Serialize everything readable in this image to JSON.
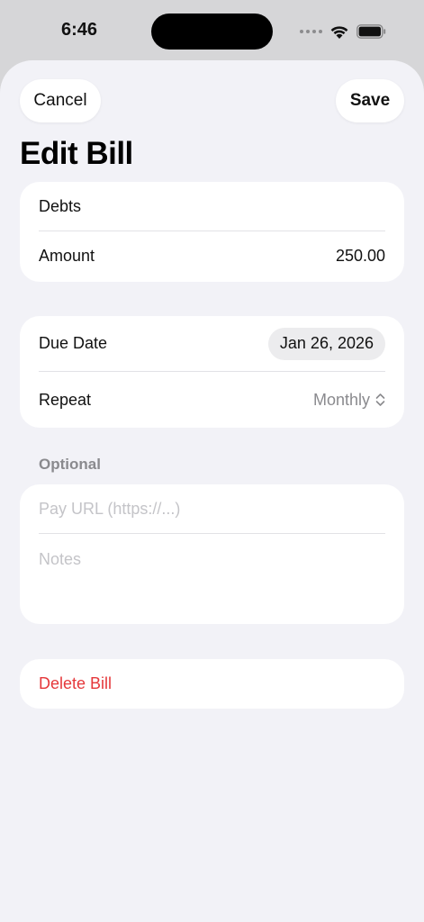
{
  "status_bar": {
    "time": "6:46"
  },
  "header": {
    "cancel_label": "Cancel",
    "save_label": "Save",
    "title": "Edit Bill"
  },
  "bill": {
    "name": "Debts",
    "amount_label": "Amount",
    "amount_value": "250.00"
  },
  "schedule": {
    "due_date_label": "Due Date",
    "due_date_value": "Jan 26, 2026",
    "repeat_label": "Repeat",
    "repeat_value": "Monthly"
  },
  "optional": {
    "header": "Optional",
    "pay_url_placeholder": "Pay URL (https://...)",
    "notes_placeholder": "Notes"
  },
  "actions": {
    "delete_label": "Delete Bill"
  },
  "colors": {
    "accent_destructive": "#e5383b",
    "background": "#f2f2f7",
    "secondary_text": "#8a8a8e"
  }
}
